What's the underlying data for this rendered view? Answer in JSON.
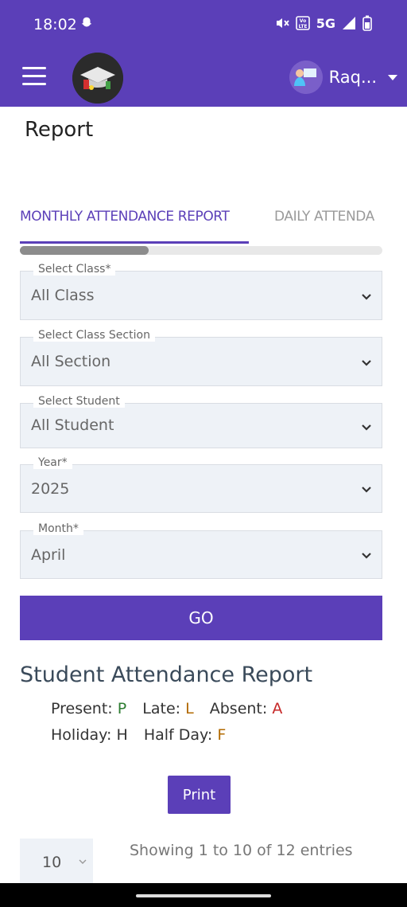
{
  "status": {
    "time": "18:02",
    "network": "5G"
  },
  "appbar": {
    "user_name": "Raq..."
  },
  "page": {
    "title": "Report"
  },
  "tabs": [
    {
      "label": "MONTHLY ATTENDANCE REPORT",
      "active": true
    },
    {
      "label": "DAILY ATTENDA",
      "active": false
    }
  ],
  "filters": {
    "class": {
      "label": "Select Class*",
      "value": "All Class"
    },
    "section": {
      "label": "Select Class Section",
      "value": "All Section"
    },
    "student": {
      "label": "Select Student",
      "value": "All Student"
    },
    "year": {
      "label": "Year*",
      "value": "2025"
    },
    "month": {
      "label": "Month*",
      "value": "April"
    }
  },
  "go_label": "GO",
  "report": {
    "title": "Student Attendance Report",
    "legend": {
      "present_label": "Present:",
      "present_code": "P",
      "late_label": "Late:",
      "late_code": "L",
      "absent_label": "Absent:",
      "absent_code": "A",
      "holiday_label": "Holiday:",
      "holiday_code": "H",
      "halfday_label": "Half Day:",
      "halfday_code": "F"
    }
  },
  "print_label": "Print",
  "table": {
    "page_size": "10",
    "entries_text": "Showing 1 to 10 of 12 entries"
  },
  "colors": {
    "brand": "#5b3fb8",
    "present": "#2e7d32",
    "late": "#b26a00",
    "absent": "#c62828"
  }
}
